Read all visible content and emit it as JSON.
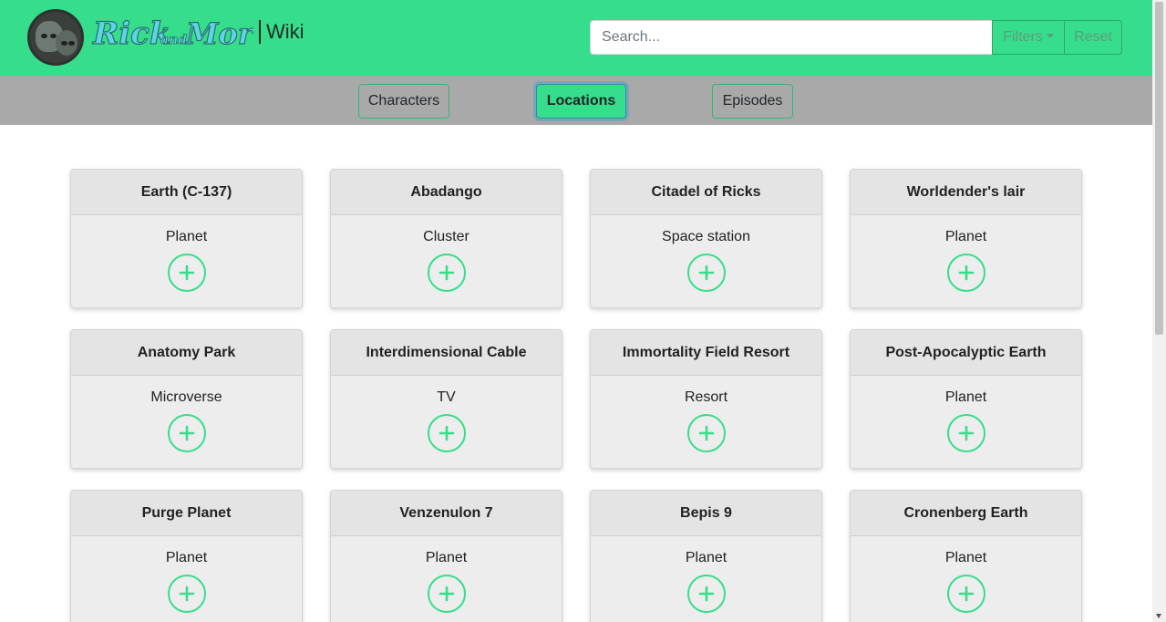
{
  "header": {
    "logo_text": "Rick and Morty",
    "wiki_label": "Wiki",
    "search_placeholder": "Search...",
    "filters_label": "Filters",
    "reset_label": "Reset"
  },
  "nav": {
    "tabs": [
      {
        "label": "Characters",
        "active": false
      },
      {
        "label": "Locations",
        "active": true
      },
      {
        "label": "Episodes",
        "active": false
      }
    ]
  },
  "colors": {
    "accent": "#36de8c",
    "navbar": "#a9a9a9",
    "card": "#ededed"
  },
  "locations": [
    {
      "name": "Earth (C-137)",
      "type": "Planet"
    },
    {
      "name": "Abadango",
      "type": "Cluster"
    },
    {
      "name": "Citadel of Ricks",
      "type": "Space station"
    },
    {
      "name": "Worldender's lair",
      "type": "Planet"
    },
    {
      "name": "Anatomy Park",
      "type": "Microverse"
    },
    {
      "name": "Interdimensional Cable",
      "type": "TV"
    },
    {
      "name": "Immortality Field Resort",
      "type": "Resort"
    },
    {
      "name": "Post-Apocalyptic Earth",
      "type": "Planet"
    },
    {
      "name": "Purge Planet",
      "type": "Planet"
    },
    {
      "name": "Venzenulon 7",
      "type": "Planet"
    },
    {
      "name": "Bepis 9",
      "type": "Planet"
    },
    {
      "name": "Cronenberg Earth",
      "type": "Planet"
    }
  ],
  "icons": {
    "add": "plus-circle-icon",
    "logo": "rick-morty-avatar-icon",
    "dropdown": "caret-down-icon"
  }
}
